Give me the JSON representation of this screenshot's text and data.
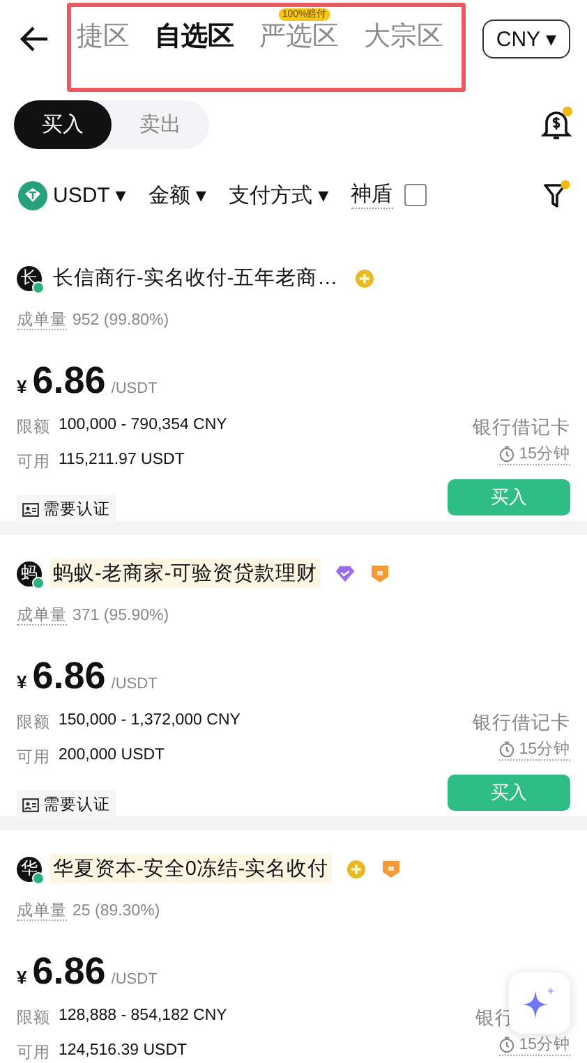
{
  "header": {
    "tabs": [
      {
        "label": "捷区",
        "selected": false
      },
      {
        "label": "自选区",
        "selected": true
      },
      {
        "label": "严选区",
        "selected": false,
        "badge": "100%赔付"
      },
      {
        "label": "大宗区",
        "selected": false
      }
    ],
    "currency": "CNY ▾"
  },
  "side_toggle": [
    {
      "label": "买入",
      "selected": true
    },
    {
      "label": "卖出",
      "selected": false
    }
  ],
  "filters": {
    "coin": "USDT ▾",
    "amount": "金额 ▾",
    "payment": "支付方式 ▾",
    "shield": {
      "label": "神盾",
      "checked": false
    }
  },
  "ads": [
    {
      "avatar": "长",
      "online": true,
      "name": "长信商行-实名收付-五年老商…",
      "highlighted": false,
      "badges": [
        {
          "kind": "coin"
        }
      ],
      "orders_label": "成单量",
      "orders": "952 (99.80%)",
      "currency_sign": "¥",
      "price": "6.86",
      "unit": "/USDT",
      "limit_label": "限额",
      "limit": "100,000 - 790,354 CNY",
      "available_label": "可用",
      "available": "115,211.97 USDT",
      "payment": "银行借记卡",
      "time": "15分钟",
      "verify": "需要认证",
      "action": "买入"
    },
    {
      "avatar": "蚂",
      "online": true,
      "name": "蚂蚁-老商家-可验资贷款理财",
      "highlighted": true,
      "badges": [
        {
          "kind": "diamond"
        },
        {
          "kind": "shield"
        }
      ],
      "orders_label": "成单量",
      "orders": "371 (95.90%)",
      "currency_sign": "¥",
      "price": "6.86",
      "unit": "/USDT",
      "limit_label": "限额",
      "limit": "150,000 - 1,372,000 CNY",
      "available_label": "可用",
      "available": "200,000 USDT",
      "payment": "银行借记卡",
      "time": "15分钟",
      "verify": "需要认证",
      "action": "买入"
    },
    {
      "avatar": "华",
      "online": true,
      "name": "华夏资本-安全0冻结-实名收付",
      "highlighted": true,
      "badges": [
        {
          "kind": "coin"
        },
        {
          "kind": "shield"
        }
      ],
      "orders_label": "成单量",
      "orders": "25 (89.30%)",
      "currency_sign": "¥",
      "price": "6.86",
      "unit": "/USDT",
      "limit_label": "限额",
      "limit": "128,888 - 854,182 CNY",
      "available_label": "可用",
      "available": "124,516.39 USDT",
      "payment": "银行",
      "time": "15分钟"
    }
  ]
}
